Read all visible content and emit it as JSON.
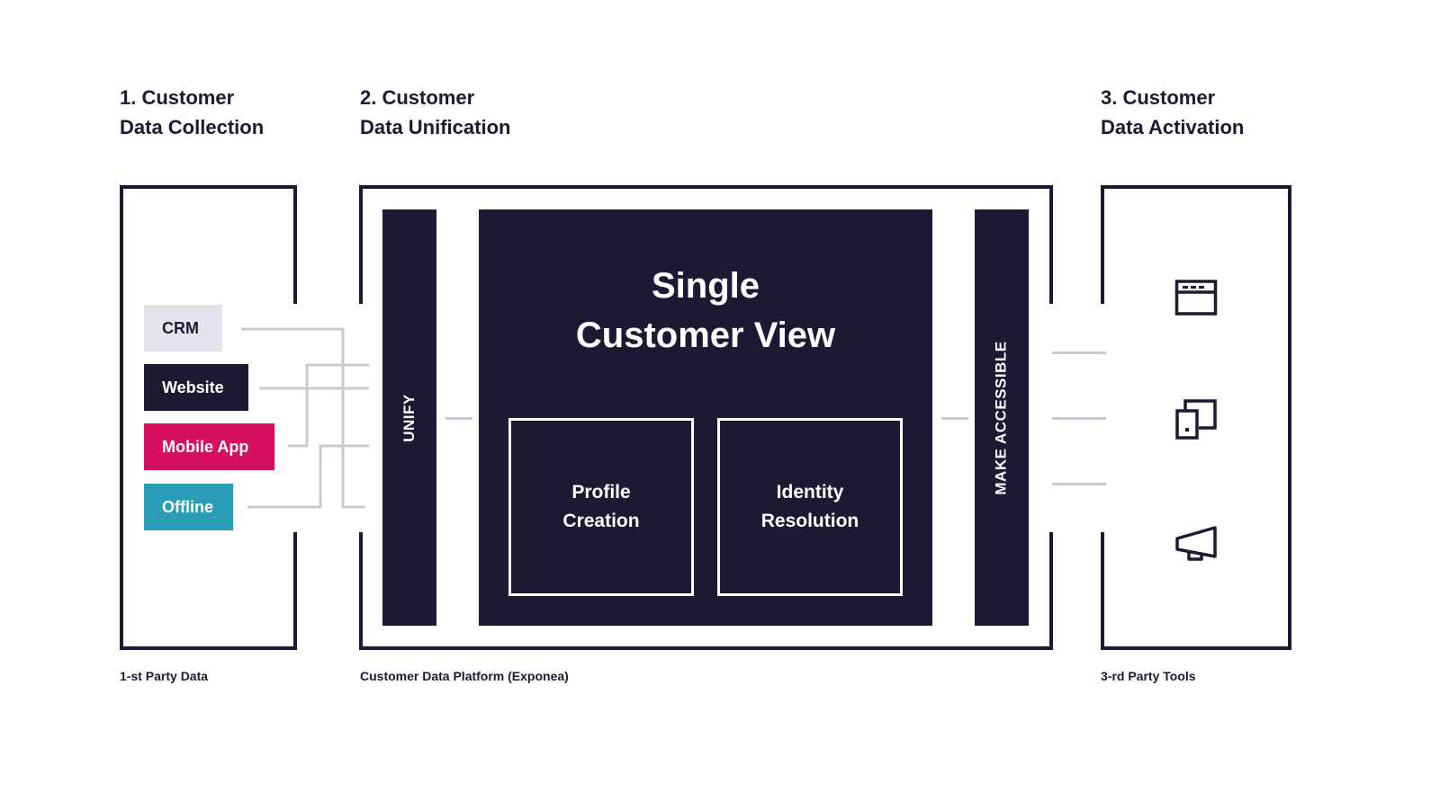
{
  "sections": [
    {
      "heading_line1": "1. Customer",
      "heading_line2": "Data Collection",
      "caption": "1-st Party Data"
    },
    {
      "heading_line1": "2. Customer",
      "heading_line2": "Data Unification",
      "caption": "Customer Data Platform (Exponea)"
    },
    {
      "heading_line1": "3. Customer",
      "heading_line2": "Data Activation",
      "caption": "3-rd Party Tools"
    }
  ],
  "sources": [
    {
      "label": "CRM",
      "bg": "#e4e4ec",
      "fg": "#1c1a33"
    },
    {
      "label": "Website",
      "bg": "#1c1a33",
      "fg": "#ffffff"
    },
    {
      "label": "Mobile App",
      "bg": "#d6105f",
      "fg": "#ffffff"
    },
    {
      "label": "Offline",
      "bg": "#2a9db6",
      "fg": "#ffffff"
    }
  ],
  "platform": {
    "unify_label": "UNIFY",
    "make_accessible_label": "MAKE ACCESSIBLE",
    "scv_line1": "Single",
    "scv_line2": "Customer View",
    "profile_line1": "Profile",
    "profile_line2": "Creation",
    "identity_line1": "Identity",
    "identity_line2": "Resolution"
  },
  "tools": [
    {
      "icon": "browser-window-icon"
    },
    {
      "icon": "devices-icon"
    },
    {
      "icon": "megaphone-icon"
    }
  ],
  "colors": {
    "navy": "#1c1a33",
    "connector": "#c9c9d3",
    "crm": "#e4e4ec",
    "mobile": "#d6105f",
    "offline": "#2a9db6"
  }
}
